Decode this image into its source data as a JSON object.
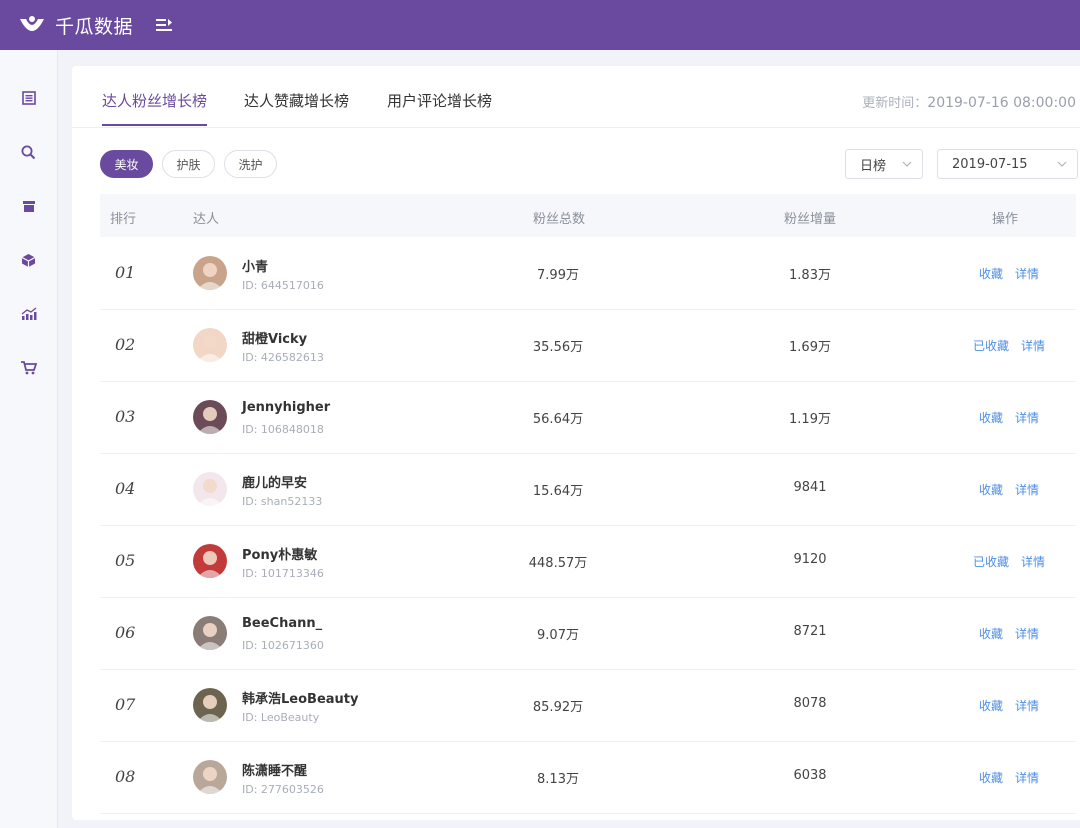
{
  "brand": {
    "name": "千瓜数据",
    "logo_icon": "logo-icon",
    "menu_icon": "menu-collapse-icon"
  },
  "colors": {
    "primary": "#6a4a9e",
    "link": "#4d8fe6",
    "header_bg": "#6a4a9e"
  },
  "sidebar": {
    "items": [
      {
        "icon": "document-icon"
      },
      {
        "icon": "search-icon"
      },
      {
        "icon": "archive-icon"
      },
      {
        "icon": "box-icon"
      },
      {
        "icon": "trend-chart-icon"
      },
      {
        "icon": "cart-icon"
      }
    ]
  },
  "tabs": [
    {
      "label": "达人粉丝增长榜",
      "active": true
    },
    {
      "label": "达人赞藏增长榜",
      "active": false
    },
    {
      "label": "用户评论增长榜",
      "active": false
    }
  ],
  "update_time": {
    "label": "更新时间：",
    "value": "2019-07-16 08:00:00"
  },
  "categories": [
    {
      "label": "美妆",
      "active": true
    },
    {
      "label": "护肤",
      "active": false
    },
    {
      "label": "洗护",
      "active": false
    }
  ],
  "period_select": {
    "value": "日榜"
  },
  "date_select": {
    "value": "2019-07-15"
  },
  "table": {
    "headers": {
      "rank": "排行",
      "user": "达人",
      "total": "粉丝总数",
      "increase": "粉丝增量",
      "ops": "操作"
    },
    "rows": [
      {
        "rank": "01",
        "name": "小青",
        "id": "ID:  644517016",
        "total": "7.99万",
        "increase": "1.83万",
        "fav": "收藏",
        "detail": "详情",
        "avatar_color": "#c9a48a"
      },
      {
        "rank": "02",
        "name": "甜橙Vicky",
        "id": "ID:  426582613",
        "total": "35.56万",
        "increase": "1.69万",
        "fav": "已收藏",
        "detail": "详情",
        "avatar_color": "#f2d6c6"
      },
      {
        "rank": "03",
        "name": "Jennyhigher",
        "id": "ID:  106848018",
        "total": "56.64万",
        "increase": "1.19万",
        "fav": "收藏",
        "detail": "详情",
        "avatar_color": "#6b4b57"
      },
      {
        "rank": "04",
        "name": "鹿儿的早安",
        "id": "ID:  shan52133",
        "total": "15.64万",
        "increase": "9841",
        "fav": "收藏",
        "detail": "详情",
        "avatar_color": "#f3e6ec"
      },
      {
        "rank": "05",
        "name": "Pony朴惠敏",
        "id": "ID:  101713346",
        "total": "448.57万",
        "increase": "9120",
        "fav": "已收藏",
        "detail": "详情",
        "avatar_color": "#c23a3a"
      },
      {
        "rank": "06",
        "name": "BeeChann_",
        "id": "ID:  102671360",
        "total": "9.07万",
        "increase": "8721",
        "fav": "收藏",
        "detail": "详情",
        "avatar_color": "#8a7c77"
      },
      {
        "rank": "07",
        "name": "韩承浩LeoBeauty",
        "id": "ID:  LeoBeauty",
        "total": "85.92万",
        "increase": "8078",
        "fav": "收藏",
        "detail": "详情",
        "avatar_color": "#6d6450"
      },
      {
        "rank": "08",
        "name": "陈潇睡不醒",
        "id": "ID:  277603526",
        "total": "8.13万",
        "increase": "6038",
        "fav": "收藏",
        "detail": "详情",
        "avatar_color": "#b9a89a"
      }
    ]
  }
}
